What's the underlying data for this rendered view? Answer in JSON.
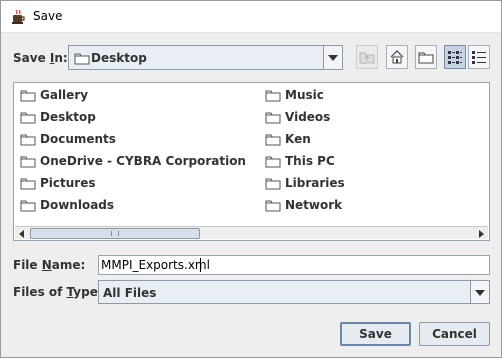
{
  "window": {
    "title": "Save"
  },
  "save_in": {
    "label": "Save In:",
    "label_prefix": "Save ",
    "label_mnemonic": "I",
    "label_suffix": "n:",
    "value": "Desktop"
  },
  "toolbar": {
    "up_icon": "folder-up-icon",
    "home_icon": "home-icon",
    "new_folder_icon": "new-folder-icon",
    "list_view_icon": "list-view-icon",
    "details_view_icon": "details-view-icon"
  },
  "files": {
    "left": [
      "Gallery",
      "Desktop",
      "Documents",
      "OneDrive - CYBRA Corporation",
      "Pictures",
      "Downloads"
    ],
    "right": [
      "Music",
      "Videos",
      "Ken",
      "This PC",
      "Libraries",
      "Network"
    ]
  },
  "file_name": {
    "label": "File Name:",
    "label_prefix": "File ",
    "label_mnemonic": "N",
    "label_suffix": "ame:",
    "value": "MMPI_Exports.xml"
  },
  "file_type": {
    "label": "Files of Type:",
    "label_prefix": "Files of ",
    "label_mnemonic": "T",
    "label_suffix": "ype:",
    "value": "All Files"
  },
  "buttons": {
    "save": "Save",
    "cancel": "Cancel"
  },
  "colors": {
    "dialog_bg": "#eeeeee",
    "control_bg": "#e9eef4",
    "border": "#8e9aa8",
    "text": "#333333"
  }
}
